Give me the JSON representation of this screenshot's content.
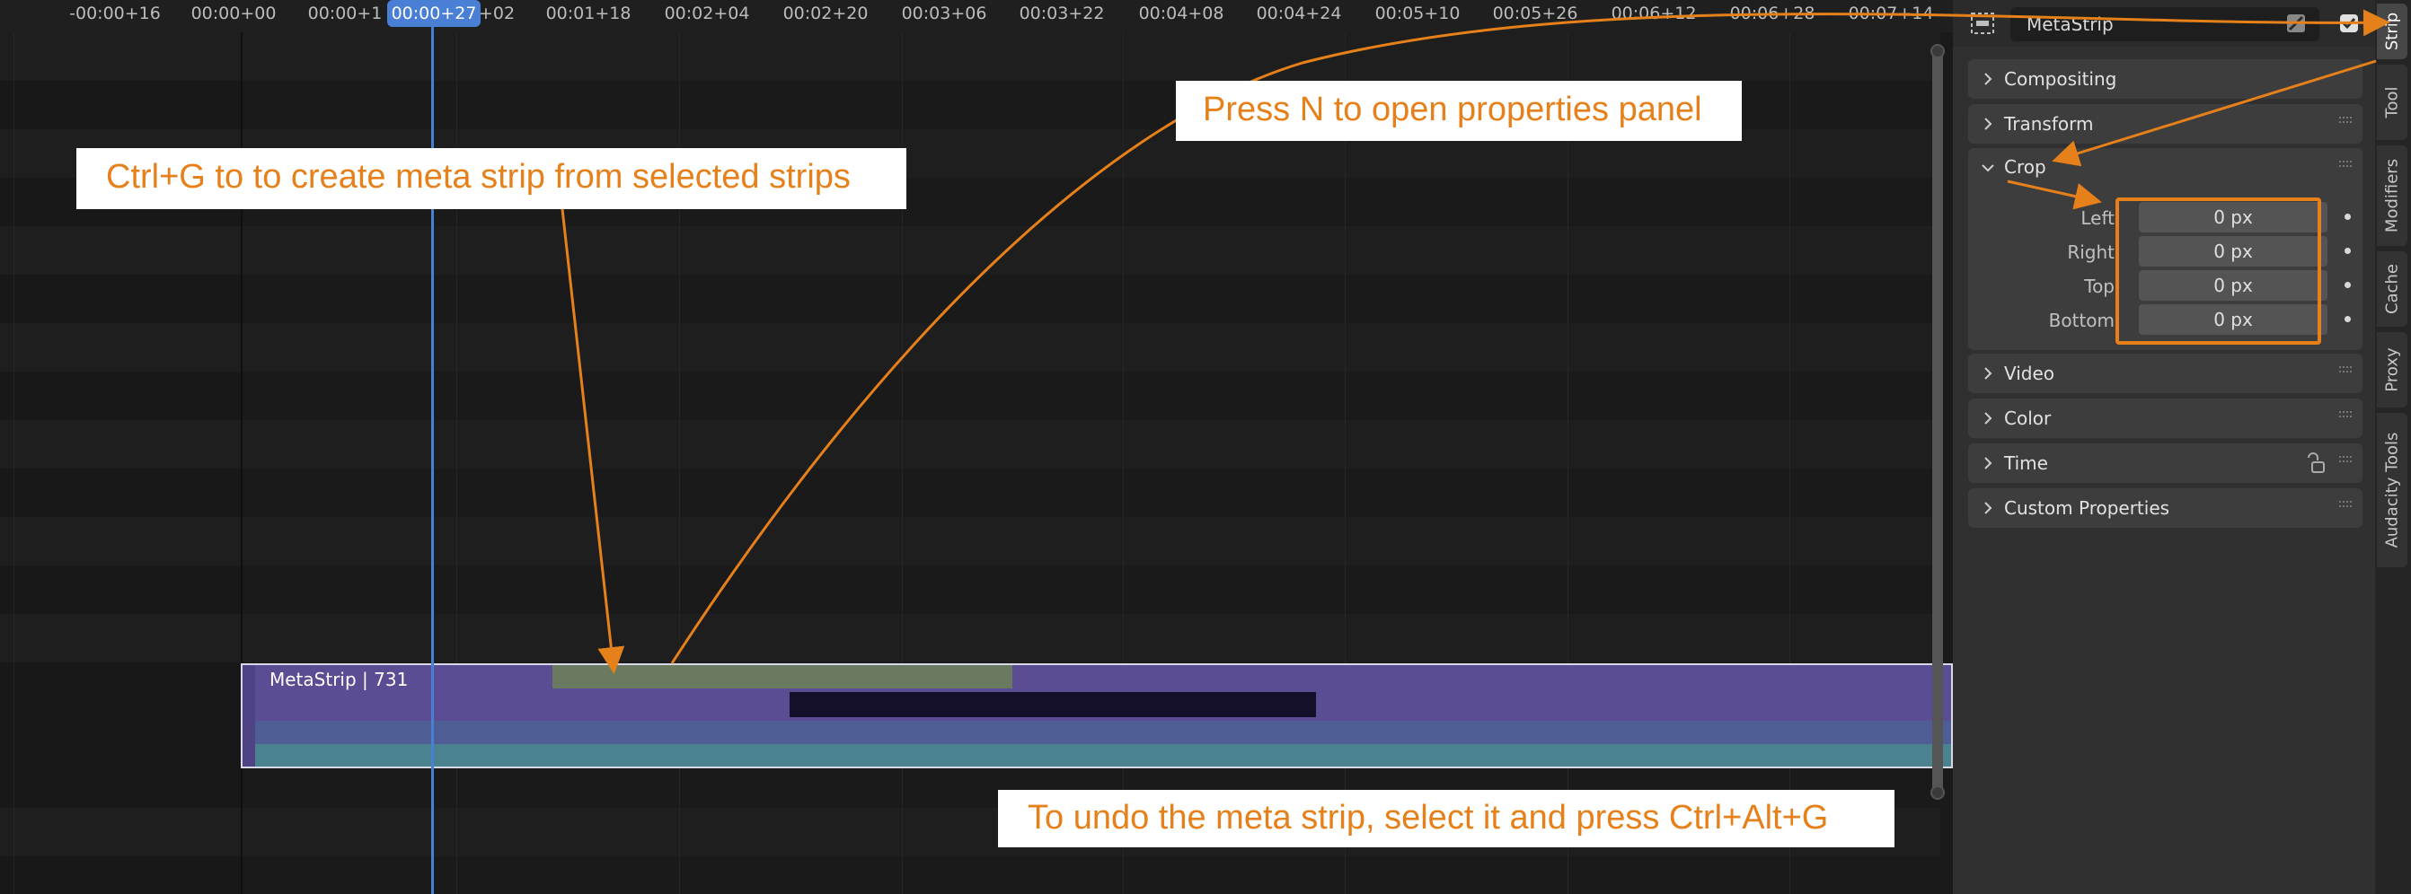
{
  "timeline": {
    "ticks": [
      "-00:00+16",
      "00:00+00",
      "00:00+1",
      "+02",
      "00:01+18",
      "00:02+04",
      "00:02+20",
      "00:03+06",
      "00:03+22",
      "00:04+08",
      "00:04+24",
      "00:05+10",
      "00:05+26",
      "00:06+12",
      "00:06+28",
      "00:07+14"
    ],
    "playhead": "00:00+27",
    "meta_strip_label": "MetaStrip | 731"
  },
  "callouts": {
    "group": "Ctrl+G to to create meta strip from selected strips",
    "props": "Press N to open properties panel",
    "undo": "To undo the meta strip, select it and press Ctrl+Alt+G"
  },
  "panel": {
    "strip_name": "MetaStrip",
    "sections": {
      "compositing": "Compositing",
      "transform": "Transform",
      "crop": "Crop",
      "video": "Video",
      "color": "Color",
      "time": "Time",
      "custom": "Custom Properties"
    },
    "crop": {
      "left_label": "Left",
      "left_value": "0 px",
      "right_label": "Right",
      "right_value": "0 px",
      "top_label": "Top",
      "top_value": "0 px",
      "bottom_label": "Bottom",
      "bottom_value": "0 px"
    }
  },
  "tabs": [
    "Strip",
    "Tool",
    "Modifiers",
    "Cache",
    "Proxy",
    "Audacity Tools"
  ],
  "colors": {
    "accent": "#e6801a",
    "playhead": "#4a7fd6",
    "meta_strip": "#5b4d93"
  }
}
